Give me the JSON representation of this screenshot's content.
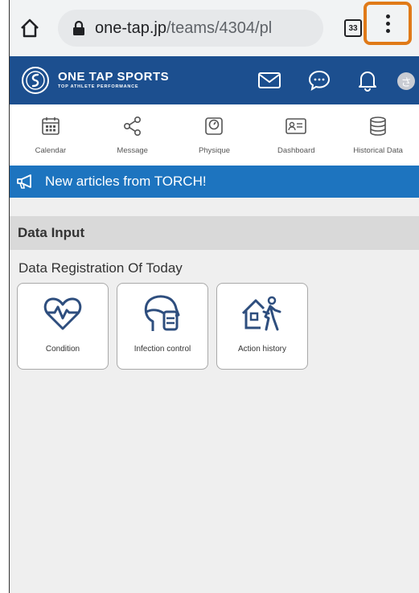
{
  "browser": {
    "url_host": "one-tap.jp",
    "url_path": "/teams/4304/pl",
    "tab_count": "33"
  },
  "app": {
    "brand_title": "ONE TAP SPORTS",
    "brand_subtitle": "TOP ATHLETE PERFORMANCE",
    "avatar_char": "さ",
    "colors": {
      "header_bg": "#1c4f8f",
      "announce_bg": "#1d74bf",
      "menu_highlight": "#e07a18"
    }
  },
  "nav": {
    "items": [
      {
        "label": "Calendar",
        "icon": "calendar-icon"
      },
      {
        "label": "Message",
        "icon": "share-icon"
      },
      {
        "label": "Physique",
        "icon": "scale-icon"
      },
      {
        "label": "Dashboard",
        "icon": "id-card-icon"
      },
      {
        "label": "Historical Data",
        "icon": "database-icon"
      }
    ]
  },
  "announcement": {
    "text": "New articles from TORCH!"
  },
  "data_input": {
    "title": "Data Input",
    "subtitle": "Data Registration Of Today",
    "cards": [
      {
        "label": "Condition",
        "icon": "heart-pulse-icon"
      },
      {
        "label": "Infection control",
        "icon": "mask-head-icon"
      },
      {
        "label": "Action history",
        "icon": "house-walker-icon"
      }
    ]
  }
}
